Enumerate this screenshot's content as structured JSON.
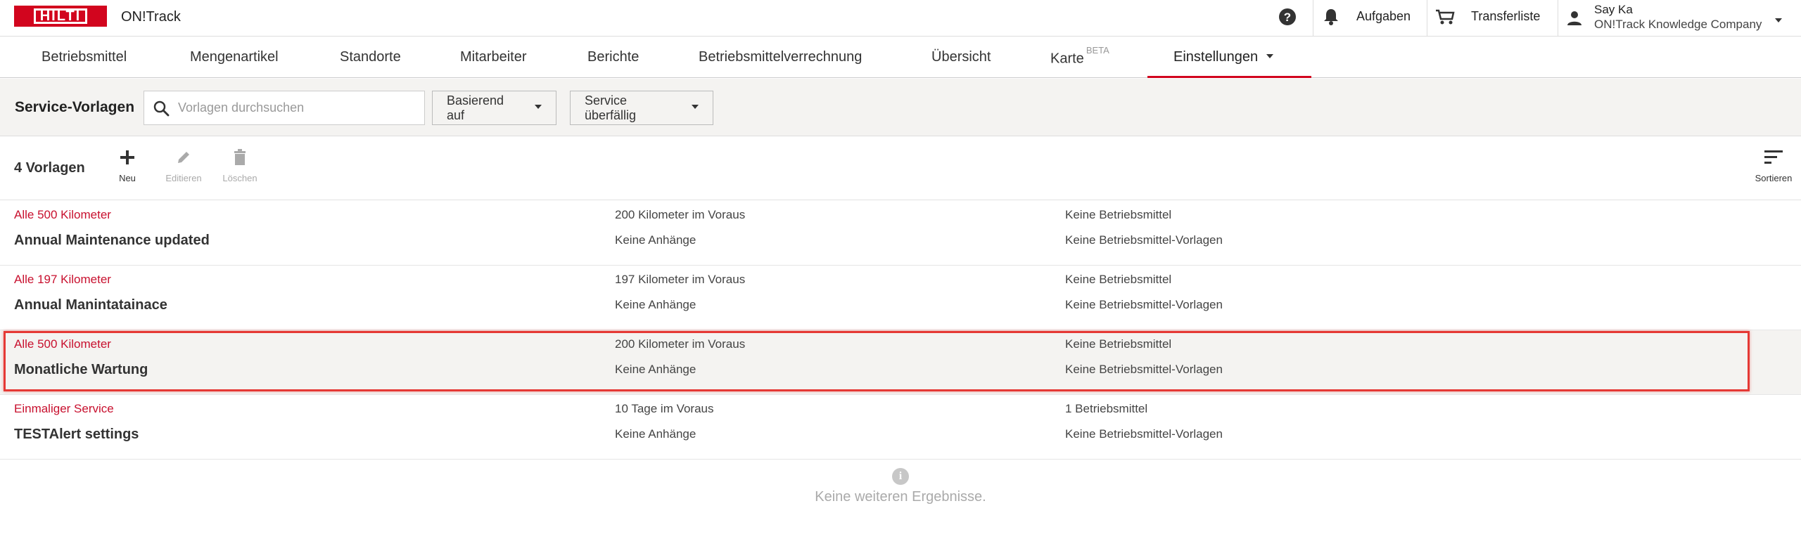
{
  "brand": {
    "logo_text": "HILTI",
    "app_name": "ON!Track",
    "accent": "#d2051e"
  },
  "header": {
    "help_icon": "help-circle-icon",
    "tasks_label": "Aufgaben",
    "transfer_label": "Transferliste",
    "user_name": "Say Ka",
    "company": "ON!Track Knowledge Company"
  },
  "nav": {
    "tabs": [
      {
        "label": "Betriebsmittel"
      },
      {
        "label": "Mengenartikel"
      },
      {
        "label": "Standorte"
      },
      {
        "label": "Mitarbeiter"
      },
      {
        "label": "Berichte"
      },
      {
        "label": "Betriebsmittelverrechnung"
      },
      {
        "label": "Übersicht"
      },
      {
        "label": "Karte",
        "badge": "BETA"
      },
      {
        "label": "Einstellungen",
        "active": true
      }
    ]
  },
  "filters": {
    "title": "Service-Vorlagen",
    "search_placeholder": "Vorlagen durchsuchen",
    "dropdown_based_on": "Basierend auf",
    "dropdown_overdue": "Service überfällig"
  },
  "toolbar": {
    "count": "4 Vorlagen",
    "new_label": "Neu",
    "edit_label": "Editieren",
    "delete_label": "Löschen",
    "sort_label": "Sortieren"
  },
  "rows": [
    {
      "frequency": "Alle 500 Kilometer",
      "name": "Annual Maintenance updated",
      "advance": "200 Kilometer im Voraus",
      "attachments": "Keine Anhänge",
      "assets": "Keine Betriebsmittel",
      "asset_templates": "Keine Betriebsmittel-Vorlagen"
    },
    {
      "frequency": "Alle 197 Kilometer",
      "name": "Annual Manintatainace",
      "advance": "197 Kilometer im Voraus",
      "attachments": "Keine Anhänge",
      "assets": "Keine Betriebsmittel",
      "asset_templates": "Keine Betriebsmittel-Vorlagen"
    },
    {
      "frequency": "Alle 500 Kilometer",
      "name": "Monatliche Wartung",
      "advance": "200 Kilometer im Voraus",
      "attachments": "Keine Anhänge",
      "assets": "Keine Betriebsmittel",
      "asset_templates": "Keine Betriebsmittel-Vorlagen",
      "highlighted": true
    },
    {
      "frequency": "Einmaliger Service",
      "name": "TESTAlert settings",
      "advance": "10 Tage im Voraus",
      "attachments": "Keine Anhänge",
      "assets": "1 Betriebsmittel",
      "asset_templates": "Keine Betriebsmittel-Vorlagen"
    }
  ],
  "footer": {
    "no_more": "Keine weiteren Ergebnisse."
  }
}
